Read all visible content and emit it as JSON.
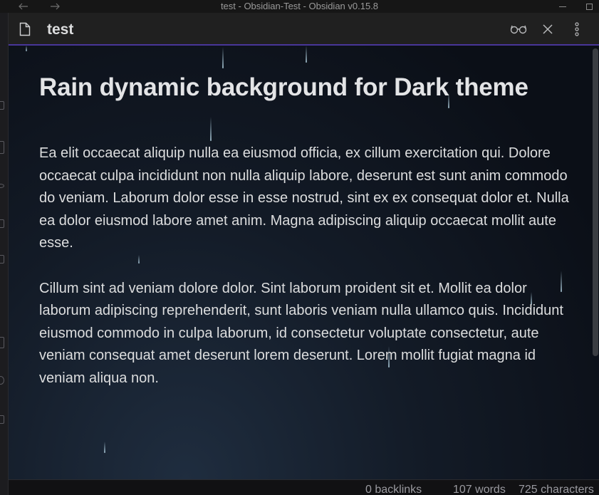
{
  "window": {
    "title": "test - Obsidian-Test - Obsidian v0.15.8",
    "back_icon": "arrow-left-icon",
    "forward_icon": "arrow-right-icon"
  },
  "view_header": {
    "title": "test",
    "file_icon": "document-icon",
    "actions": [
      "reading-glasses-icon",
      "close-icon",
      "more-vertical-icon"
    ]
  },
  "note": {
    "heading": "Rain dynamic background for Dark theme",
    "paragraphs": [
      "Ea elit occaecat aliquip nulla ea eiusmod officia, ex cillum exercitation qui. Dolore occaecat culpa incididunt non nulla aliquip labore, deserunt est sunt anim commodo do veniam. Laborum dolor esse in esse nostrud, sint ex ex consequat dolor et. Nulla ea dolor eiusmod labore amet anim. Magna adipiscing aliquip occaecat mollit aute esse.",
      "Cillum sint ad veniam dolore dolor. Sint laborum proident sit et. Mollit ea dolor laborum adipiscing reprehenderit, sunt laboris veniam nulla ullamco quis. Incididunt eiusmod commodo in culpa laborum, id consectetur voluptate consectetur, aute veniam consequat amet deserunt lorem deserunt. Lorem mollit fugiat magna id veniam aliqua non."
    ]
  },
  "status_bar": {
    "backlinks": "0 backlinks",
    "words": "107 words",
    "characters": "725 characters"
  },
  "colors": {
    "accent": "#483699",
    "header_bg": "#202020",
    "text": "#dcddde"
  }
}
